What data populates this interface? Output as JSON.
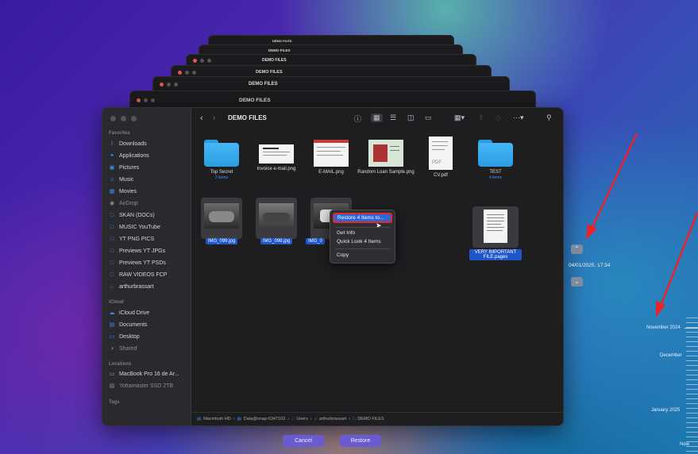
{
  "window_title": "DEMO FILES",
  "stack_titles": [
    "DEMO FILES",
    "DEMO FILES",
    "DEMO FILES",
    "DEMO FILES",
    "DEMO FILES",
    "DEMO FILES"
  ],
  "sidebar": {
    "favorites_header": "Favorites",
    "favorites": [
      {
        "label": "Downloads",
        "icon": "download-icon"
      },
      {
        "label": "Applications",
        "icon": "applications-icon"
      },
      {
        "label": "Pictures",
        "icon": "pictures-icon"
      },
      {
        "label": "Music",
        "icon": "music-icon"
      },
      {
        "label": "Movies",
        "icon": "movies-icon"
      },
      {
        "label": "AirDrop",
        "icon": "airdrop-icon"
      },
      {
        "label": "SKAN (DOCs)",
        "icon": "folder-icon"
      },
      {
        "label": "MUSIC YouTube",
        "icon": "folder-icon"
      },
      {
        "label": "YT PNG PICS",
        "icon": "folder-icon"
      },
      {
        "label": "Previews YT JPGs",
        "icon": "folder-icon"
      },
      {
        "label": "Previews YT PSDs",
        "icon": "folder-icon"
      },
      {
        "label": "RAW VIDEOS FCP",
        "icon": "folder-icon"
      },
      {
        "label": "arthurbrassart",
        "icon": "home-icon"
      }
    ],
    "icloud_header": "iCloud",
    "icloud": [
      {
        "label": "iCloud Drive",
        "icon": "cloud-icon"
      },
      {
        "label": "Documents",
        "icon": "document-icon"
      },
      {
        "label": "Desktop",
        "icon": "desktop-icon"
      },
      {
        "label": "Shared",
        "icon": "shared-icon"
      }
    ],
    "locations_header": "Locations",
    "locations": [
      {
        "label": "MacBook Pro 16 de Ar...",
        "icon": "laptop-icon"
      },
      {
        "label": "Yottamaster SSD 2TB",
        "icon": "drive-icon"
      }
    ],
    "tags_header": "Tags"
  },
  "files": {
    "row1": [
      {
        "name": "Top Secret",
        "sub": "2 items",
        "kind": "folder"
      },
      {
        "name": "Invoice e-mail.png",
        "sub": "",
        "kind": "image"
      },
      {
        "name": "E-MAIL.png",
        "sub": "",
        "kind": "image"
      },
      {
        "name": "Random Loan Sample.png",
        "sub": "",
        "kind": "image"
      },
      {
        "name": "CV.pdf",
        "sub": "",
        "kind": "pdf"
      },
      {
        "name": "TEST",
        "sub": "4 items",
        "kind": "folder"
      }
    ],
    "row2": [
      {
        "name": "IMG_099.jpg"
      },
      {
        "name": "IMG_098.jpg"
      },
      {
        "name": "IMG_0"
      },
      {
        "name": "VERY IMPORTANT FILE.pages"
      }
    ]
  },
  "context_menu": {
    "restore": "Restore 4 Items to...",
    "get_info": "Get Info",
    "quick_look": "Quick Look 4 Items",
    "copy": "Copy"
  },
  "pathbar": [
    "Macintosh HD",
    "Data@snap-6347103",
    "Users",
    "arthurbrassart",
    "DEMO FILES"
  ],
  "buttons": {
    "cancel": "Cancel",
    "restore": "Restore"
  },
  "time_machine": {
    "date": "04/01/2025, 17:34",
    "timeline": [
      "November 2024",
      "December",
      "January 2025",
      "Now"
    ]
  },
  "colors": {
    "accent": "#2b67d6",
    "highlight_border": "#e02a2a",
    "annotation_arrow": "#e8232a"
  }
}
